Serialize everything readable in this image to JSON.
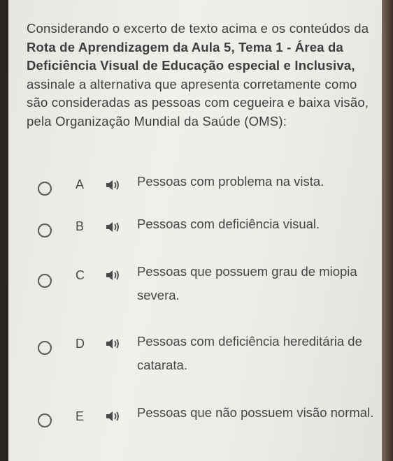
{
  "question": {
    "part1": "Considerando o excerto de texto acima e os conteúdos da ",
    "bold": "Rota de Aprendizagem da Aula 5, Tema 1 - Área da Deficiência Visual de Educação especial e Inclusiva,",
    "part2": " assinale a alternativa que apresenta corretamente como são consideradas as pessoas com cegueira e baixa visão, pela Organização Mundial da Saúde (OMS):"
  },
  "options": [
    {
      "letter": "A",
      "text": "Pessoas com problema na vista."
    },
    {
      "letter": "B",
      "text": "Pessoas com deficiência visual."
    },
    {
      "letter": "C",
      "text": "Pessoas que possuem grau de miopia severa."
    },
    {
      "letter": "D",
      "text": "Pessoas com deficiência hereditária de catarata."
    },
    {
      "letter": "E",
      "text": "Pessoas que não possuem visão normal."
    }
  ],
  "icons": {
    "radio": "radio-circle",
    "audio": "speaker-icon"
  }
}
